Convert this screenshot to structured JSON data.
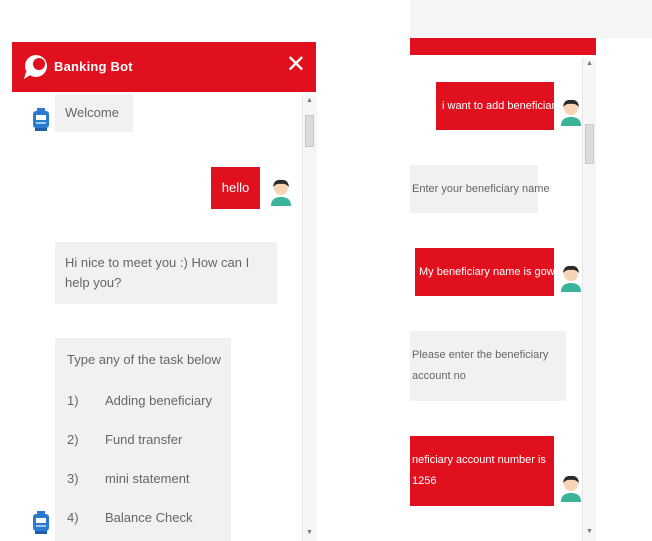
{
  "left_chat": {
    "title": "Banking Bot",
    "close_glyph": "✕",
    "messages": {
      "welcome": "Welcome",
      "hello": "hello",
      "nice": "Hi nice to meet you :) How can I help you?",
      "task_intro": "Type any of the task below",
      "tasks": [
        {
          "num": "1)",
          "label": "Adding beneficiary"
        },
        {
          "num": "2)",
          "label": "Fund transfer"
        },
        {
          "num": "3)",
          "label": "mini statement"
        },
        {
          "num": "4)",
          "label": "Balance Check"
        }
      ]
    }
  },
  "right_chat": {
    "messages": {
      "add_beneficiary": "i want to add beneficiary",
      "enter_name": "Enter your beneficiary name",
      "name_reply": "My beneficiary name is gowri",
      "enter_account": "Please enter the beneficiary account no",
      "account_reply": "neficiary account number is 1256"
    }
  },
  "colors": {
    "brand_red": "#e0101e",
    "bot_bubble": "#f1f1f1"
  },
  "icons": {
    "logo": "chat-bubble-icon",
    "close": "close-icon",
    "bot": "robot-icon",
    "user": "user-avatar-icon"
  }
}
